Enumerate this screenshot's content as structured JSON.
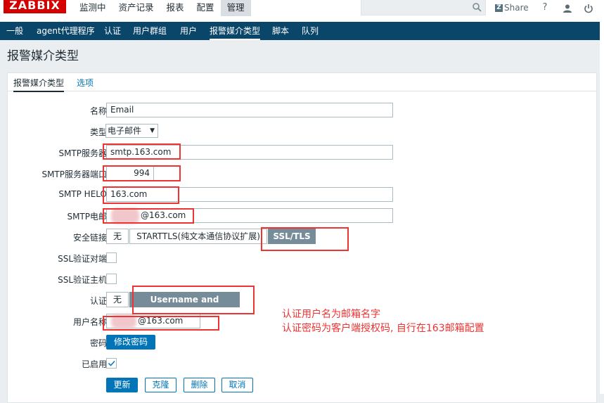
{
  "app": {
    "logo": "ZABBIX"
  },
  "main_menu": [
    "监测中",
    "资产记录",
    "报表",
    "配置",
    "管理"
  ],
  "main_menu_active": "管理",
  "header": {
    "share": "Share",
    "share_badge": "Z",
    "help": "?",
    "user": "user-icon",
    "power": "power-icon"
  },
  "sub_menu": [
    "一般",
    "agent代理程序",
    "认证",
    "用户群组",
    "用户",
    "报警媒介类型",
    "脚本",
    "队列"
  ],
  "sub_menu_active": "报警媒介类型",
  "page_title": "报警媒介类型",
  "tabs": {
    "active": "报警媒介类型",
    "other": "选项"
  },
  "form": {
    "name_label": "名称",
    "name_value": "Email",
    "type_label": "类型",
    "type_value": "电子邮件",
    "smtp_server_label": "SMTP服务器",
    "smtp_server_value": "smtp.163.com",
    "smtp_port_label": "SMTP服务器端口",
    "smtp_port_value": "994",
    "smtp_helo_label": "SMTP HELO",
    "smtp_helo_value": "163.com",
    "smtp_email_label": "SMTP电邮",
    "smtp_email_value": "@163.com",
    "security_label": "安全链接",
    "security_options": [
      "无",
      "STARTTLS(纯文本通信协议扩展)",
      "SSL/TLS"
    ],
    "security_selected": "SSL/TLS",
    "ssl_peer_label": "SSL验证对端",
    "ssl_host_label": "SSL验证主机",
    "auth_label": "认证",
    "auth_options": [
      "无",
      "Username and password"
    ],
    "auth_selected": "Username and password",
    "username_label": "用户名称",
    "username_value": "@163.com",
    "password_label": "密码",
    "password_button": "修改密码",
    "enabled_label": "已启用",
    "enabled": true
  },
  "buttons": {
    "update": "更新",
    "clone": "克隆",
    "delete": "删除",
    "cancel": "取消"
  },
  "annotation": [
    "认证用户名为邮箱名字",
    "认证密码为客户端授权码, 自行在163邮箱配置"
  ],
  "colors": {
    "accent": "#0275b8",
    "nav": "#0a466a",
    "annotation": "#ee3333",
    "logo": "#d40000"
  }
}
